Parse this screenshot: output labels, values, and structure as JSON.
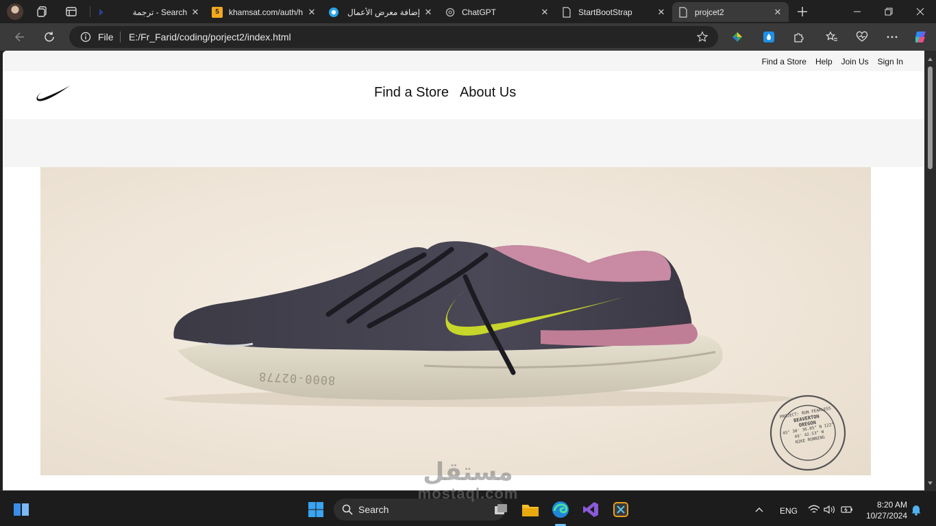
{
  "browser": {
    "tabs": [
      {
        "title": "ترجمة - Search",
        "active": false
      },
      {
        "title": "khamsat.com/auth/h",
        "badge": "5",
        "active": false
      },
      {
        "title": "إضافة معرض الأعمال",
        "active": false
      },
      {
        "title": "ChatGPT",
        "active": false
      },
      {
        "title": "StartBootStrap",
        "active": false
      },
      {
        "title": "projcet2",
        "active": true
      }
    ],
    "address": {
      "scheme": "File",
      "url": "E:/Fr_Farid/coding/porject2/index.html"
    },
    "colors": {
      "frame": "#202020",
      "toolbar": "#3a3a3a",
      "omnibox": "#242424"
    }
  },
  "page": {
    "utility_links": [
      "Find a Store",
      "Help",
      "Join Us",
      "Sign In"
    ],
    "nav_links": [
      "Find a Store",
      "About Us"
    ],
    "logo": "nike-swoosh-icon",
    "hero": {
      "stamp": {
        "top": "PROJECT: RUN FEARLESS",
        "middle": [
          "BEAVERTON",
          "OREGON"
        ],
        "coords": "45° 30' 36.05\" N 122° 49' 42.53\" W",
        "bottom": "NIKE RUNNING"
      },
      "sole_text": "8000-02778"
    }
  },
  "taskbar": {
    "search_label": "Search",
    "language": "ENG",
    "time": "8:20 AM",
    "date": "10/27/2024"
  },
  "watermark": {
    "arabic": "مستقل",
    "latin": "mostaql.com"
  }
}
